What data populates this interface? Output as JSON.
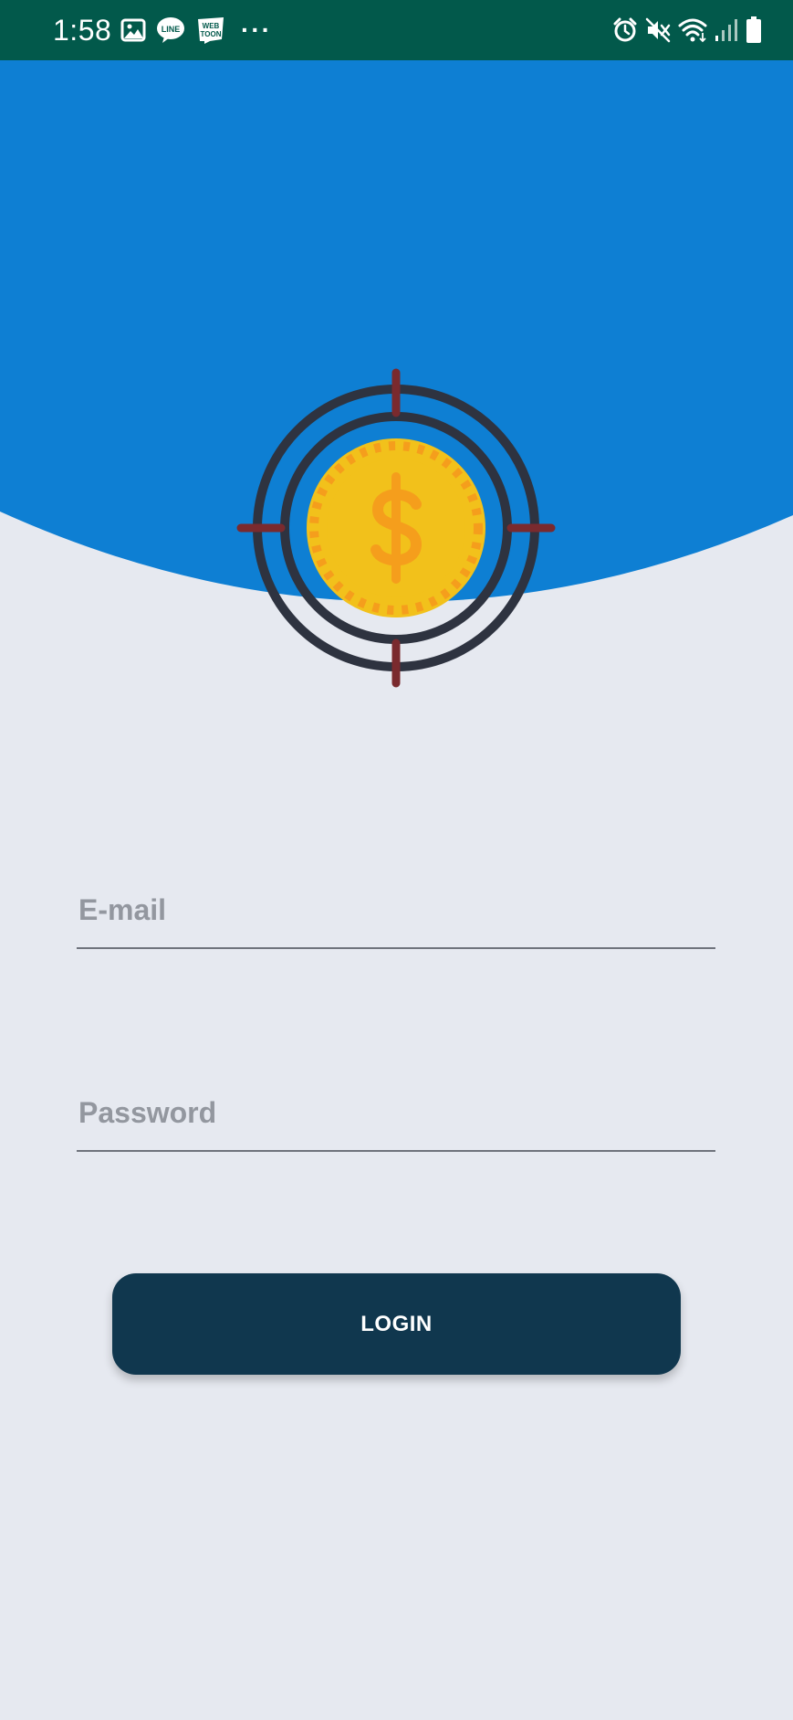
{
  "status_bar": {
    "time": "1:58",
    "left_icons": [
      "gallery-icon",
      "line-app-icon",
      "webtoon-app-icon",
      "more-dots-icon"
    ],
    "line_icon_text": "LINE",
    "webtoon_icon_text_top": "WEB",
    "webtoon_icon_text_bottom": "TOON",
    "more_text": "···",
    "right_icons": [
      "alarm-icon",
      "mute-icon",
      "wifi-icon",
      "signal-icon",
      "battery-icon"
    ]
  },
  "login_form": {
    "email_placeholder": "E-mail",
    "password_placeholder": "Password",
    "login_label": "LOGIN"
  },
  "colors": {
    "status_bar": "#02594b",
    "header": "#0e7fd3",
    "background": "#e6e9f0",
    "button": "#10374e",
    "target_ring": "#2e3340",
    "crosshair": "#7a2a2e",
    "coin": "#f2c11b",
    "coin_accent": "#f59e1c"
  }
}
